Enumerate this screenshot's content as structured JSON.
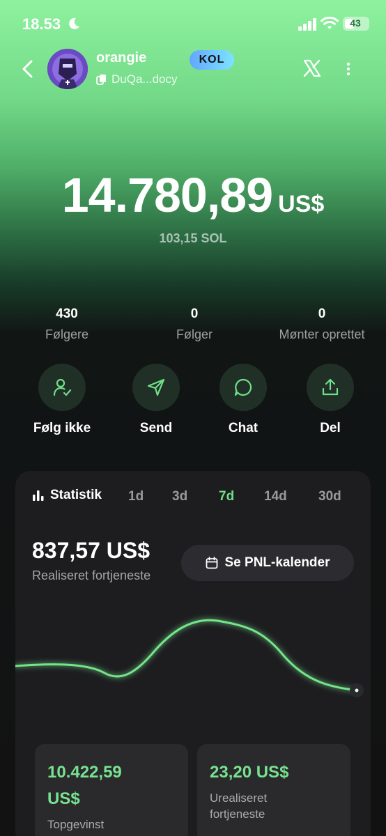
{
  "status": {
    "time": "18.53",
    "battery": "43"
  },
  "profile": {
    "name": "orangie",
    "badge": "KOL",
    "address": "DuQa...docy"
  },
  "balance": {
    "value": "14.780,89",
    "unit": "US$",
    "sol": "103,15 SOL"
  },
  "stats": [
    {
      "value": "430",
      "label": "Følgere"
    },
    {
      "value": "0",
      "label": "Følger"
    },
    {
      "value": "0",
      "label": "Mønter oprettet"
    }
  ],
  "actions": [
    {
      "label": "Følg ikke",
      "icon": "user-check-icon"
    },
    {
      "label": "Send",
      "icon": "send-icon"
    },
    {
      "label": "Chat",
      "icon": "chat-icon"
    },
    {
      "label": "Del",
      "icon": "share-icon"
    }
  ],
  "statistics": {
    "title": "Statistik",
    "tabs": [
      "1d",
      "3d",
      "7d",
      "14d",
      "30d"
    ],
    "active_tab": "7d",
    "pnl_amount": "837,57 US$",
    "pnl_label": "Realiseret fortjeneste",
    "calendar_label": "Se PNL-kalender",
    "tiles": [
      {
        "value_line1": "10.422,59",
        "value_line2": "US$",
        "label_line1": "Topgevinst",
        "label_line2": ""
      },
      {
        "value_line1": "23,20 US$",
        "value_line2": "",
        "label_line1": "Urealiseret",
        "label_line2": "fortjeneste"
      }
    ]
  },
  "colors": {
    "accent": "#6fe087",
    "card": "#1d1d20"
  }
}
